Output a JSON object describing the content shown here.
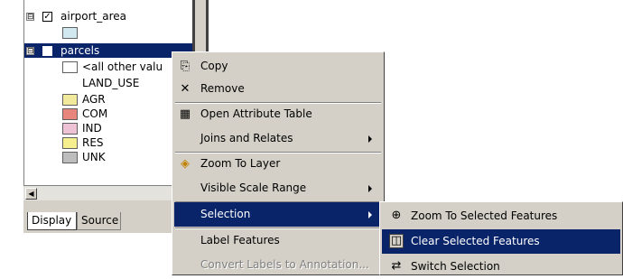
{
  "toc": {
    "layers": [
      {
        "name": "airport_area",
        "expanded": true,
        "checked": true
      },
      {
        "name": "parcels",
        "expanded": true,
        "checked": true,
        "selected": true
      }
    ],
    "parcels_legend": {
      "other_values_label": "<all other valu",
      "field_heading": "LAND_USE",
      "classes": [
        {
          "label": "AGR",
          "color": "#f1ea9c"
        },
        {
          "label": "COM",
          "color": "#e8857c"
        },
        {
          "label": "IND",
          "color": "#ecc2d4"
        },
        {
          "label": "RES",
          "color": "#f6ef8e"
        },
        {
          "label": "UNK",
          "color": "#bdbdbd"
        }
      ]
    },
    "airport_symbol_color": "#d2e8f1",
    "tabs": {
      "display": "Display",
      "source": "Source"
    },
    "expander_symbol": "⊟",
    "check_symbol": "✓",
    "scroll_left_arrow": "◀"
  },
  "context_menu": {
    "items": [
      {
        "label": "Copy",
        "icon": "copy-icon",
        "glyph": "⎘"
      },
      {
        "label": "Remove",
        "icon": "remove-icon",
        "glyph": "✕"
      },
      {
        "label": "Open Attribute Table",
        "icon": "table-icon",
        "glyph": "▦"
      },
      {
        "label": "Joins and Relates",
        "icon": "",
        "glyph": "",
        "submenu": true
      },
      {
        "label": "Zoom To Layer",
        "icon": "zoom-to-layer-icon",
        "glyph": "◈"
      },
      {
        "label": "Visible Scale Range",
        "icon": "",
        "glyph": "",
        "submenu": true
      },
      {
        "label": "Selection",
        "icon": "",
        "glyph": "",
        "submenu": true,
        "highlighted": true
      },
      {
        "label": "Label Features",
        "icon": "",
        "glyph": ""
      },
      {
        "label": "Convert Labels to Annotation...",
        "icon": "",
        "glyph": "",
        "disabled": true
      }
    ]
  },
  "selection_submenu": {
    "items": [
      {
        "label": "Zoom To Selected Features",
        "icon": "zoom-selected-icon",
        "glyph": "⊕"
      },
      {
        "label": "Clear Selected Features",
        "icon": "clear-selection-icon",
        "glyph": "◫",
        "highlighted": true
      },
      {
        "label": "Switch Selection",
        "icon": "switch-selection-icon",
        "glyph": "⇄"
      }
    ]
  },
  "colors": {
    "highlight": "#0a246a",
    "menu_face": "#d4d0c8"
  }
}
